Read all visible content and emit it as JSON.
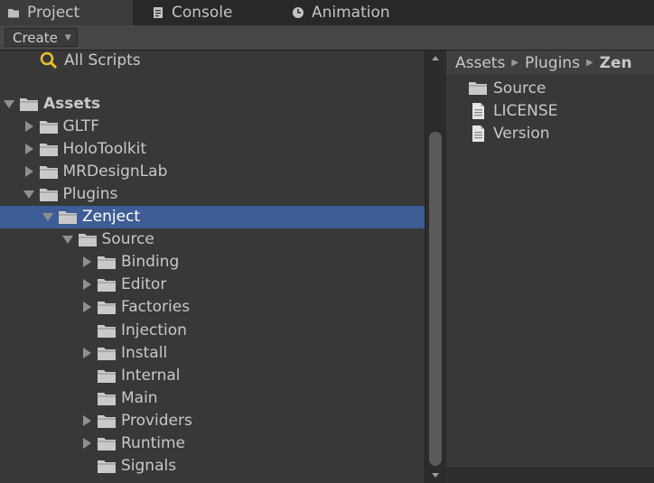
{
  "tabs": [
    {
      "label": "Project",
      "icon": "folder-icon",
      "active": true
    },
    {
      "label": "Console",
      "icon": "console-icon",
      "active": false
    },
    {
      "label": "Animation",
      "icon": "clock-icon",
      "active": false
    }
  ],
  "toolbar": {
    "create_label": "Create"
  },
  "favorites": {
    "all_scripts": "All Scripts"
  },
  "tree": [
    {
      "label": "Assets",
      "arrow": "down"
    },
    {
      "label": "GLTF",
      "arrow": "right"
    },
    {
      "label": "HoloToolkit",
      "arrow": "right"
    },
    {
      "label": "MRDesignLab",
      "arrow": "right"
    },
    {
      "label": "Plugins",
      "arrow": "down"
    },
    {
      "label": "Zenject",
      "arrow": "down",
      "selected": true
    },
    {
      "label": "Source",
      "arrow": "down"
    },
    {
      "label": "Binding",
      "arrow": "right"
    },
    {
      "label": "Editor",
      "arrow": "right"
    },
    {
      "label": "Factories",
      "arrow": "right"
    },
    {
      "label": "Injection",
      "arrow": "none"
    },
    {
      "label": "Install",
      "arrow": "right"
    },
    {
      "label": "Internal",
      "arrow": "none"
    },
    {
      "label": "Main",
      "arrow": "none"
    },
    {
      "label": "Providers",
      "arrow": "right"
    },
    {
      "label": "Runtime",
      "arrow": "right"
    },
    {
      "label": "Signals",
      "arrow": "none"
    }
  ],
  "breadcrumb": [
    "Assets",
    "Plugins",
    "Zen"
  ],
  "contents": [
    {
      "label": "Source",
      "icon": "folder-icon"
    },
    {
      "label": "LICENSE",
      "icon": "file-icon"
    },
    {
      "label": "Version",
      "icon": "file-icon"
    }
  ],
  "colors": {
    "selection": "#3e5d96",
    "background": "#383838",
    "search_icon": "#e8c030"
  }
}
